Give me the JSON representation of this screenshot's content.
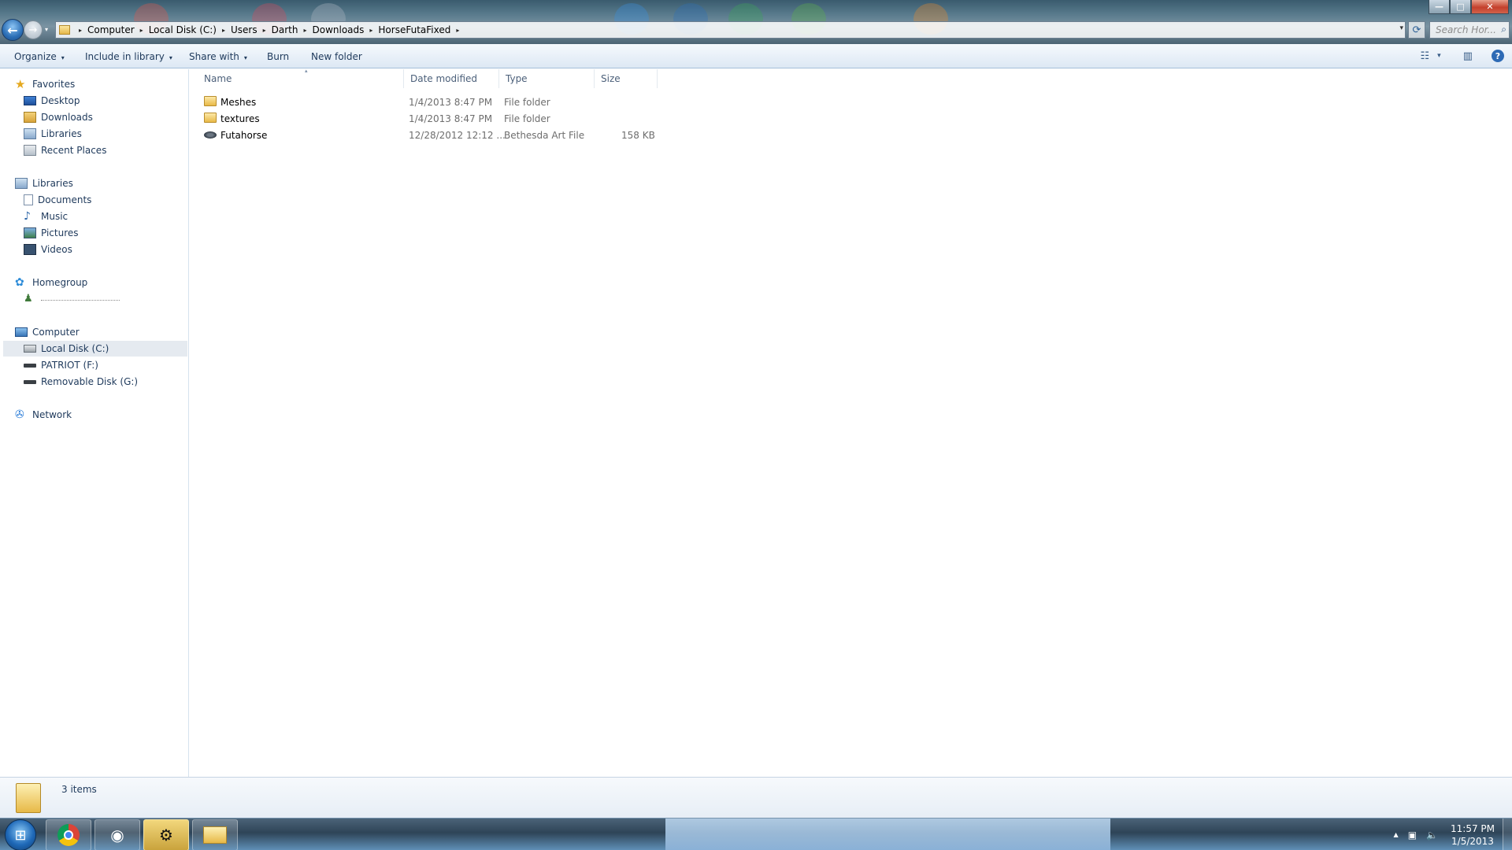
{
  "window": {
    "controls": {
      "minimize": "—",
      "maximize": "□",
      "close": "✕"
    }
  },
  "nav_buttons": {
    "back": "←",
    "forward": "→",
    "recent": "▾"
  },
  "address": {
    "crumbs": [
      "Computer",
      "Local Disk (C:)",
      "Users",
      "Darth",
      "Downloads",
      "HorseFutaFixed"
    ],
    "separator": "▸",
    "dropdown": "▾",
    "refresh": "⟳"
  },
  "search": {
    "placeholder": "Search Hor...",
    "icon": "⌕"
  },
  "toolbar": {
    "organize": "Organize",
    "include_in_library": "Include in library",
    "share_with": "Share with",
    "burn": "Burn",
    "new_folder": "New folder",
    "caret": "▾",
    "view_icon": "☷",
    "view_caret": "▾",
    "preview_icon": "▥",
    "help_icon": "?"
  },
  "navigation": {
    "favorites": "Favorites",
    "favorites_items": [
      "Desktop",
      "Downloads",
      "Libraries",
      "Recent Places"
    ],
    "libraries": "Libraries",
    "libraries_items": [
      "Documents",
      "Music",
      "Pictures",
      "Videos"
    ],
    "homegroup": "Homegroup",
    "computer": "Computer",
    "computer_items": [
      "Local Disk (C:)",
      "PATRIOT (F:)",
      "Removable Disk (G:)"
    ],
    "network": "Network",
    "selected": "Local Disk (C:)",
    "icons": {
      "star": "★",
      "music": "♪",
      "homegroup": "✿",
      "user": "♟",
      "network": "✇"
    }
  },
  "columns": {
    "name": "Name",
    "date_modified": "Date modified",
    "type": "Type",
    "size": "Size",
    "sort_indicator": "▴"
  },
  "files": [
    {
      "name": "Meshes",
      "date": "1/4/2013 8:47 PM",
      "type": "File folder",
      "size": "",
      "icon": "folder-icon"
    },
    {
      "name": "textures",
      "date": "1/4/2013 8:47 PM",
      "type": "File folder",
      "size": "",
      "icon": "folder-icon"
    },
    {
      "name": "Futahorse",
      "date": "12/28/2012 12:12 ...",
      "type": "Bethesda Art File",
      "size": "158 KB",
      "icon": "nif-file-icon"
    }
  ],
  "status": {
    "item_count": "3 items"
  },
  "taskbar": {
    "start_glyph": "⊞",
    "steam_glyph": "⚙",
    "app_glyph": "◉",
    "tray_icons": {
      "up_arrow": "▲",
      "network": "▣",
      "volume": "🔈"
    },
    "clock_time": "11:57 PM",
    "clock_date": "1/5/2013"
  }
}
